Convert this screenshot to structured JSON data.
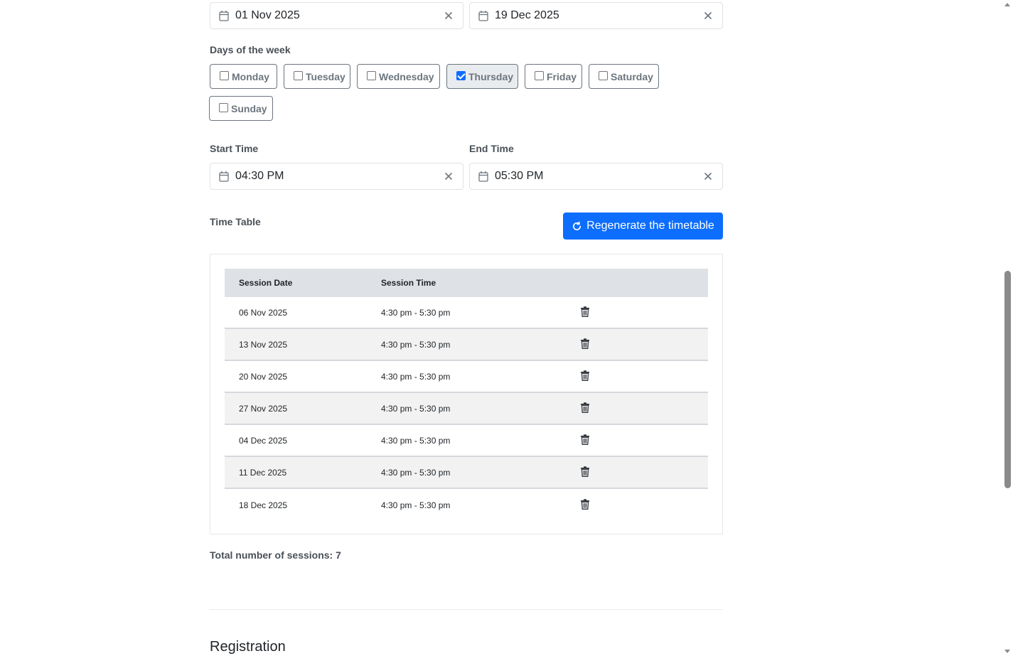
{
  "dates": {
    "start_value": "01 Nov 2025",
    "end_value": "19 Dec 2025"
  },
  "days": {
    "label": "Days of the week",
    "items": [
      {
        "label": "Monday",
        "checked": false
      },
      {
        "label": "Tuesday",
        "checked": false
      },
      {
        "label": "Wednesday",
        "checked": false
      },
      {
        "label": "Thursday",
        "checked": true
      },
      {
        "label": "Friday",
        "checked": false
      },
      {
        "label": "Saturday",
        "checked": false
      },
      {
        "label": "Sunday",
        "checked": false
      }
    ]
  },
  "times": {
    "start_label": "Start Time",
    "start_value": "04:30 PM",
    "end_label": "End Time",
    "end_value": "05:30 PM"
  },
  "timetable": {
    "label": "Time Table",
    "regenerate_label": "Regenerate the timetable",
    "headers": [
      "Session Date",
      "Session Time",
      ""
    ],
    "rows": [
      {
        "date": "06 Nov 2025",
        "time": "4:30 pm - 5:30 pm"
      },
      {
        "date": "13 Nov 2025",
        "time": "4:30 pm - 5:30 pm"
      },
      {
        "date": "20 Nov 2025",
        "time": "4:30 pm - 5:30 pm"
      },
      {
        "date": "27 Nov 2025",
        "time": "4:30 pm - 5:30 pm"
      },
      {
        "date": "04 Dec 2025",
        "time": "4:30 pm - 5:30 pm"
      },
      {
        "date": "11 Dec 2025",
        "time": "4:30 pm - 5:30 pm"
      },
      {
        "date": "18 Dec 2025",
        "time": "4:30 pm - 5:30 pm"
      }
    ],
    "total_text": "Total number of sessions: 7"
  },
  "registration": {
    "title": "Registration"
  },
  "colors": {
    "primary": "#0d6efd",
    "header_bg": "#dee2e6",
    "stripe_bg": "#f2f2f2"
  },
  "icons": {
    "calendar": "calendar-icon",
    "clear": "close-icon",
    "delete": "trash-icon",
    "regenerate": "refresh-icon"
  }
}
